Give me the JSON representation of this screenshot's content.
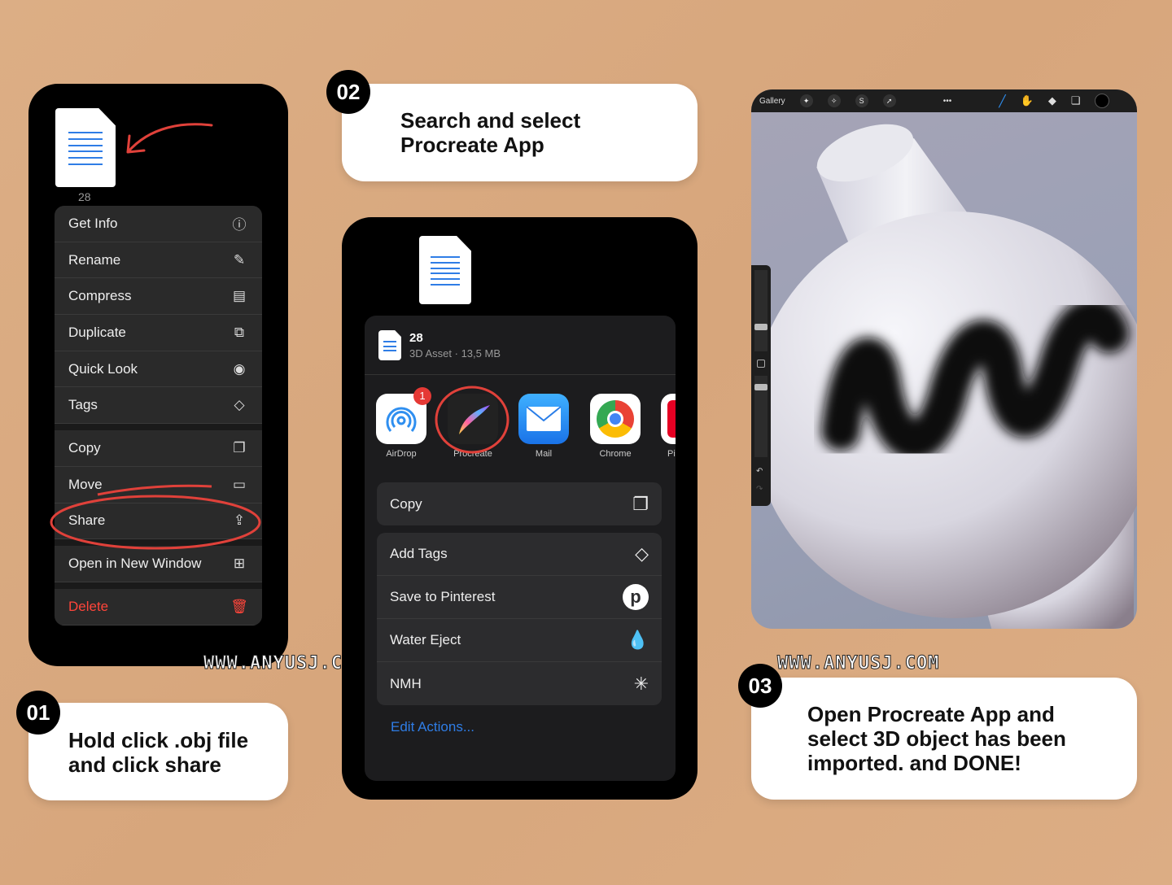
{
  "step1": {
    "number": "01",
    "text_line1": "Hold click .obj file",
    "text_line2": "and click share",
    "file_name": "28",
    "menu": [
      {
        "label": "Get Info",
        "icon": "info-icon"
      },
      {
        "label": "Rename",
        "icon": "pencil-icon"
      },
      {
        "label": "Compress",
        "icon": "archive-icon"
      },
      {
        "label": "Duplicate",
        "icon": "duplicate-icon"
      },
      {
        "label": "Quick Look",
        "icon": "eye-icon"
      },
      {
        "label": "Tags",
        "icon": "tag-icon"
      },
      {
        "label": "Copy",
        "icon": "copy-icon"
      },
      {
        "label": "Move",
        "icon": "folder-icon"
      },
      {
        "label": "Share",
        "icon": "share-icon"
      },
      {
        "label": "Open in New Window",
        "icon": "grid-icon"
      },
      {
        "label": "Delete",
        "icon": "trash-icon"
      }
    ]
  },
  "step2": {
    "number": "02",
    "text_line1": "Search and select",
    "text_line2": "Procreate App",
    "file_name": "28",
    "file_meta": "3D Asset · 13,5 MB",
    "apps": [
      {
        "label": "AirDrop",
        "badge": "1"
      },
      {
        "label": "Procreate"
      },
      {
        "label": "Mail"
      },
      {
        "label": "Chrome"
      },
      {
        "label": "Pi"
      }
    ],
    "actions": [
      {
        "label": "Copy",
        "icon": "copy-icon"
      },
      {
        "label": "Add Tags",
        "icon": "tag-icon"
      },
      {
        "label": "Save to Pinterest",
        "icon": "pinterest-icon"
      },
      {
        "label": "Water Eject",
        "icon": "drop-icon"
      },
      {
        "label": "NMH",
        "icon": "sparkle-icon"
      }
    ],
    "edit_actions": "Edit Actions..."
  },
  "step3": {
    "number": "03",
    "text_line1": "Open Procreate App and",
    "text_line2": "select 3D object has been",
    "text_line3": "imported. and DONE!",
    "toolbar_gallery": "Gallery"
  },
  "watermark": "WWW.ANYUSJ.COM",
  "colors": {
    "accent_red": "#e0413a",
    "link_blue": "#2f7de6",
    "delete_red": "#ff453a"
  }
}
